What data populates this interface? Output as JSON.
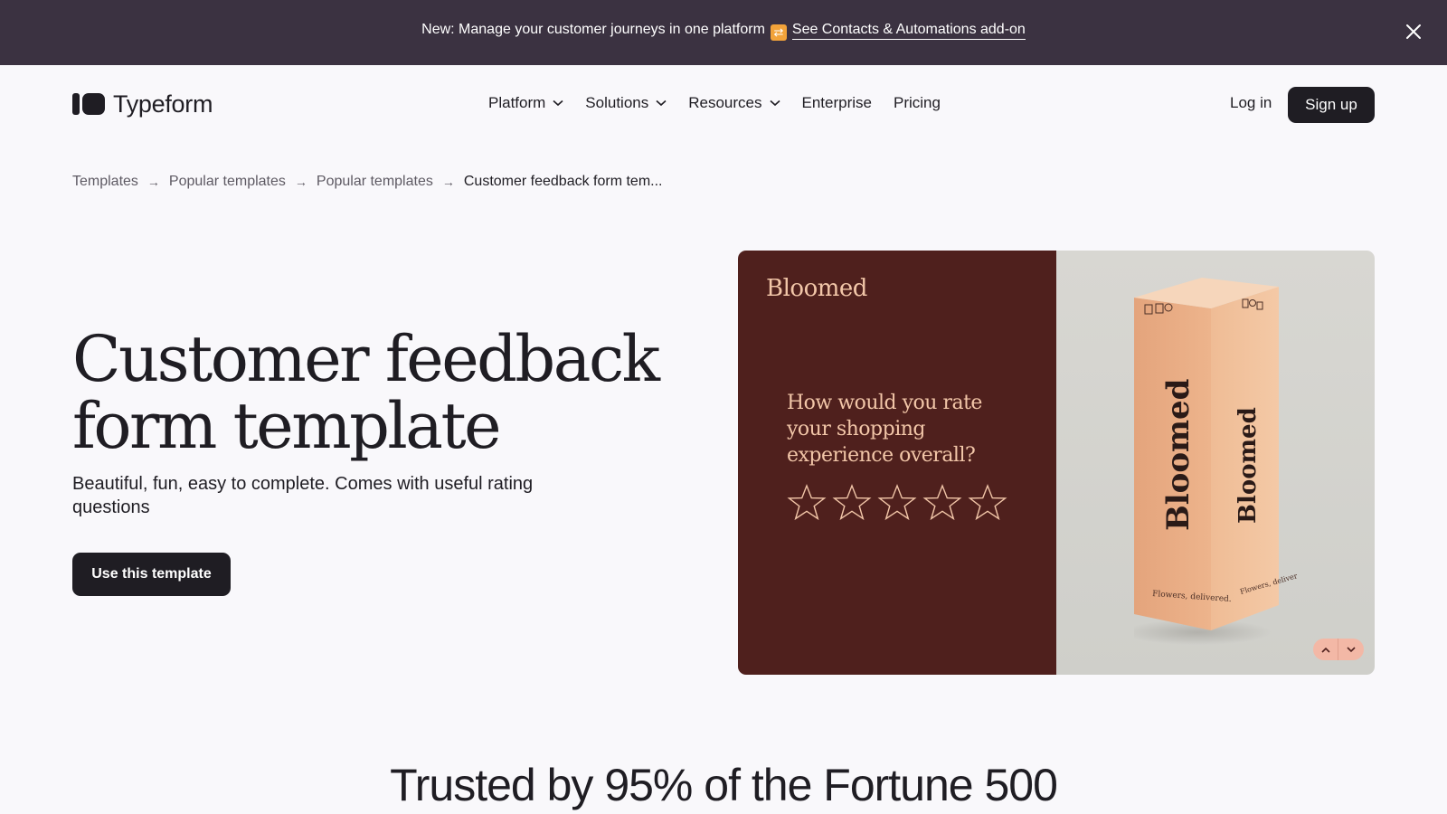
{
  "announcement": {
    "text": "New: Manage your customer journeys in one platform",
    "emoji": "🔀",
    "link_label": "See Contacts & Automations add-on"
  },
  "header": {
    "brand": "Typeform",
    "nav": [
      {
        "label": "Platform",
        "has_dropdown": true
      },
      {
        "label": "Solutions",
        "has_dropdown": true
      },
      {
        "label": "Resources",
        "has_dropdown": true
      },
      {
        "label": "Enterprise",
        "has_dropdown": false
      },
      {
        "label": "Pricing",
        "has_dropdown": false
      }
    ],
    "login_label": "Log in",
    "signup_label": "Sign up"
  },
  "breadcrumb": [
    "Templates",
    "Popular templates",
    "Popular templates",
    "Customer feedback form tem..."
  ],
  "hero": {
    "title_line1": "Customer feedback",
    "title_line2": "form template",
    "subtitle": "Beautiful, fun, easy to complete. Comes with useful rating questions",
    "cta_label": "Use this template"
  },
  "preview": {
    "brand": "Bloomed",
    "question": "How would you rate your shopping experience overall?",
    "star_count": 5,
    "box_brand": "Bloomed",
    "box_tagline": "Flowers, delivered.",
    "colors": {
      "panel": "#4f201d",
      "accent": "#f2c6a8",
      "box": "#e8a97e"
    }
  },
  "trusted": {
    "heading": "Trusted by 95% of the Fortune 500"
  }
}
